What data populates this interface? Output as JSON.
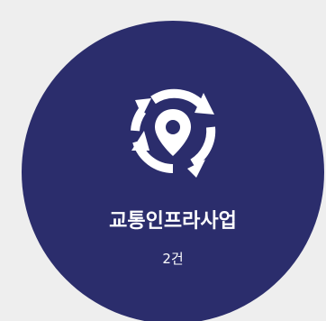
{
  "card": {
    "title": "교통인프라사업",
    "count": "2건",
    "icon": "location-refresh-icon",
    "background_color": "#2b2d6c",
    "page_background": "#eeeeee"
  }
}
